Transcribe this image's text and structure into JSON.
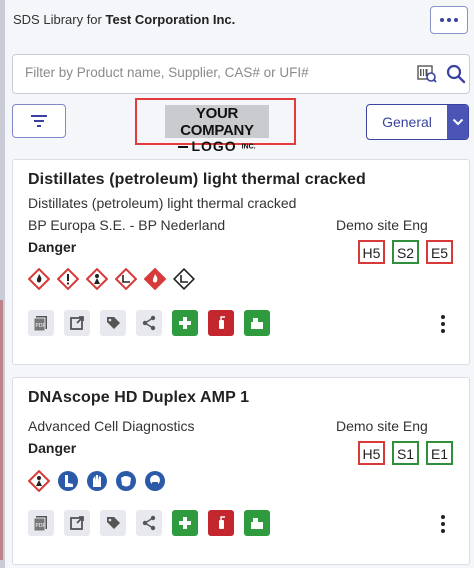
{
  "header": {
    "title_prefix": "SDS Library for",
    "company": "Test Corporation Inc."
  },
  "search": {
    "placeholder": "Filter by Product name, Supplier, CAS# or UFI#",
    "value": ""
  },
  "logo": {
    "line1": "YOUR COMPANY",
    "line2": "LOGO",
    "suffix": "INC."
  },
  "view_select": {
    "selected": "General"
  },
  "colors": {
    "accent": "#3a43a0",
    "code_red": "#d83a3a",
    "code_green": "#2f8f3a",
    "logo_highlight": "#e23b3b"
  },
  "products": [
    {
      "name": "Distillates (petroleum) light thermal cracked",
      "subtitle": "Distillates (petroleum) light thermal cracked",
      "supplier": "BP Europa S.E. - BP Nederland",
      "signal_word": "Danger",
      "site": "Demo site Eng",
      "codes": [
        {
          "label": "H5",
          "status": "red"
        },
        {
          "label": "S2",
          "status": "green"
        },
        {
          "label": "E5",
          "status": "red"
        }
      ],
      "pictograms": [
        "flammable-icon",
        "exclamation-icon",
        "health-hazard-icon",
        "environment-icon",
        "flame-red-icon",
        "environment-alt-icon"
      ],
      "actions": [
        "pdf-icon",
        "open-external-icon",
        "tag-icon",
        "share-icon",
        "first-aid-icon",
        "fire-extinguisher-icon",
        "spill-kit-icon"
      ]
    },
    {
      "name": "DNAscope HD Duplex AMP 1",
      "subtitle": "",
      "supplier": "Advanced Cell Diagnostics",
      "signal_word": "Danger",
      "site": "Demo site Eng",
      "codes": [
        {
          "label": "H5",
          "status": "red"
        },
        {
          "label": "S1",
          "status": "green"
        },
        {
          "label": "E1",
          "status": "green"
        }
      ],
      "pictograms": [
        "health-hazard-icon",
        "safety-boots-icon",
        "gloves-icon",
        "face-shield-icon",
        "respirator-icon"
      ],
      "actions": [
        "pdf-icon",
        "open-external-icon",
        "tag-icon",
        "share-icon",
        "first-aid-icon",
        "fire-extinguisher-icon",
        "spill-kit-icon"
      ]
    }
  ]
}
